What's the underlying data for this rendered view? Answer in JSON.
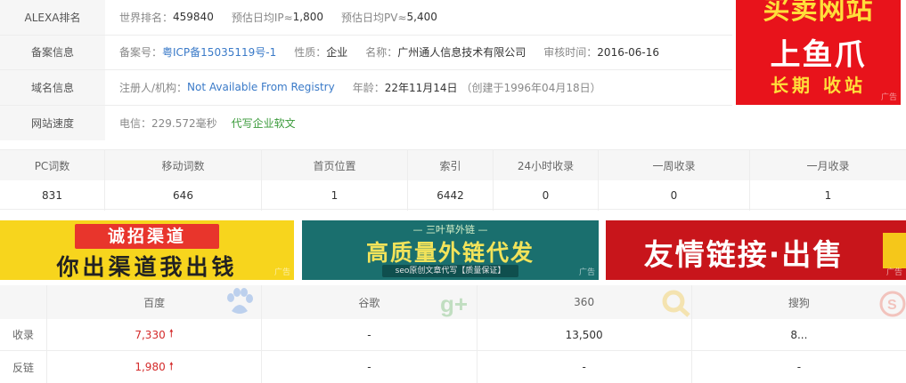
{
  "info": {
    "alexa": {
      "label": "ALEXA排名",
      "world_rank_key": "世界排名：",
      "world_rank": "459840",
      "ip_key": "预估日均IP≈",
      "ip": "1,800",
      "pv_key": "预估日均PV≈",
      "pv": "5,400"
    },
    "beian": {
      "label": "备案信息",
      "num_key": "备案号：",
      "num": "粤ICP备15035119号-1",
      "type_key": "性质：",
      "type": "企业",
      "name_key": "名称：",
      "name": "广州通人信息技术有限公司",
      "date_key": "审核时间：",
      "date": "2016-06-16"
    },
    "domain": {
      "label": "域名信息",
      "registrant_key": "注册人/机构：",
      "registrant": "Not Available From Registry",
      "age_key": "年龄：",
      "age": "22年11月14日",
      "created": "（创建于1996年04月18日）"
    },
    "speed": {
      "label": "网站速度",
      "telecom": "电信：229.572毫秒",
      "link": "代写企业软文"
    }
  },
  "ad_right": {
    "line1": "买卖网站",
    "line2": "上鱼爪",
    "line3": "长期 收站",
    "tag": "广告"
  },
  "stats": {
    "headers": [
      "PC词数",
      "移动词数",
      "首页位置",
      "索引",
      "24小时收录",
      "一周收录",
      "一月收录"
    ],
    "values": [
      "831",
      "646",
      "1",
      "6442",
      "0",
      "0",
      "1"
    ]
  },
  "banners": {
    "b1": {
      "pill": "诚招渠道",
      "sub": "你出渠道我出钱",
      "tag": "广告"
    },
    "b2": {
      "top": "— 三叶草外链 —",
      "mid": "高质量外链代发",
      "bot": "seo原创文章代写【质量保证】",
      "tag": "广告"
    },
    "b3": {
      "text": "友情链接·出售",
      "tag": "广告"
    }
  },
  "engines": {
    "headers": [
      "百度",
      "谷歌",
      "360",
      "搜狗"
    ],
    "rows": [
      {
        "label": "收录",
        "values": [
          "7,330",
          "-",
          "13,500",
          "8..."
        ]
      },
      {
        "label": "反链",
        "values": [
          "1,980",
          "-",
          "-",
          "-"
        ]
      }
    ]
  },
  "colors": {
    "label_bg": "#f6f6f6",
    "link_blue": "#3a7ac8",
    "link_green": "#3a9a3a",
    "up_red": "#d42b2b"
  }
}
